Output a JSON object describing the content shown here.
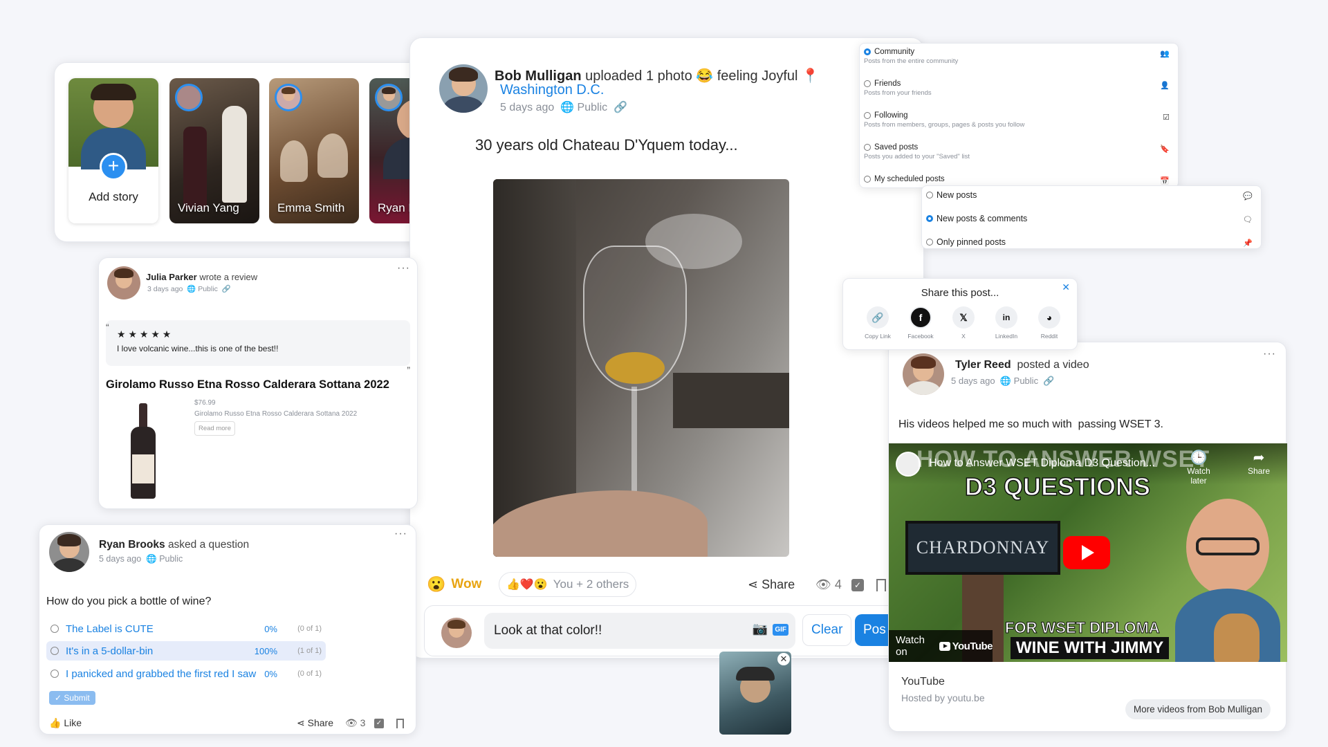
{
  "stories": {
    "add_label": "Add story",
    "items": [
      {
        "name": "Vivian Yang"
      },
      {
        "name": "Emma Smith"
      },
      {
        "name": "Ryan Brooks"
      }
    ]
  },
  "main_post": {
    "author": "Bob Mulligan",
    "action": "uploaded 1 photo 😂 feeling Joyful",
    "location": "Washington D.C.",
    "time": "5 days ago",
    "privacy": "Public",
    "text": "30 years old Chateau D'Yquem today...",
    "reaction_label": "Wow",
    "reaction_summary": "You + 2 others",
    "share_label": "Share",
    "views": "4",
    "comment_value": "Look at that color!!",
    "clear_label": "Clear",
    "post_label": "Pos",
    "gif_label": "GIF"
  },
  "review": {
    "author": "Julia Parker",
    "action": "wrote a review",
    "time": "3 days ago",
    "privacy": "Public",
    "rating": 5,
    "stars": "★ ★ ★ ★ ★",
    "quote": "I love volcanic wine...this is one of the best!!",
    "product_title": "Girolamo Russo Etna Rosso Calderara Sottana 2022",
    "price": "$76.99",
    "product_name": "Girolamo Russo Etna Rosso Calderara Sottana 2022",
    "read_more": "Read more"
  },
  "poll": {
    "author": "Ryan Brooks",
    "action": "asked a question",
    "time": "5 days ago",
    "privacy": "Public",
    "question": "How do you pick a bottle of wine?",
    "options": [
      {
        "label": "The Label is CUTE",
        "percent": "0%",
        "count": "(0 of 1)",
        "value": 0
      },
      {
        "label": "It's in a 5-dollar-bin",
        "percent": "100%",
        "count": "(1 of 1)",
        "value": 1
      },
      {
        "label": "I panicked and grabbed the first red I saw",
        "percent": "0%",
        "count": "(0 of 1)",
        "value": 0
      }
    ],
    "submit_label": "✓ Submit",
    "like_label": "Like",
    "share_label": "Share",
    "views": "3"
  },
  "feed_filter": {
    "items": [
      {
        "title": "Community",
        "subtitle": "Posts from the entire community",
        "selected": true,
        "icon": "users-icon"
      },
      {
        "title": "Friends",
        "subtitle": "Posts from your friends",
        "selected": false,
        "icon": "friends-icon"
      },
      {
        "title": "Following",
        "subtitle": "Posts from members, groups, pages & posts you follow",
        "selected": false,
        "icon": "check-square-icon"
      },
      {
        "title": "Saved posts",
        "subtitle": "Posts you added to your \"Saved\" list",
        "selected": false,
        "icon": "bookmark-icon"
      },
      {
        "title": "My scheduled posts",
        "subtitle": "",
        "selected": false,
        "icon": "calendar-icon"
      }
    ]
  },
  "sort_menu": {
    "items": [
      {
        "title": "New posts",
        "selected": false,
        "icon": "comment-icon"
      },
      {
        "title": "New posts & comments",
        "selected": true,
        "icon": "comments-icon"
      },
      {
        "title": "Only pinned posts",
        "selected": false,
        "icon": "pin-icon"
      }
    ]
  },
  "share_popup": {
    "title": "Share this post...",
    "buttons": [
      {
        "label": "Copy Link",
        "glyph": "🔗"
      },
      {
        "label": "Facebook",
        "glyph": "f"
      },
      {
        "label": "X",
        "glyph": "𝕏"
      },
      {
        "label": "LinkedIn",
        "glyph": "in"
      },
      {
        "label": "Reddit",
        "glyph": "◕"
      }
    ]
  },
  "video_post": {
    "author": "Tyler Reed",
    "action": "posted a video",
    "time": "5 days ago",
    "privacy": "Public",
    "text": "His videos helped me so much with  passing WSET 3.",
    "video_title": "How to Answer WSET Diploma D3 Question...",
    "thumb_headline_1": "HOW TO ANSWER WSET",
    "thumb_headline_2": "D3 QUESTIONS",
    "thumb_sign": "CHARDONNAY",
    "thumb_footer_1": "FOR WSET DIPLOMA",
    "thumb_footer_2": "WINE WITH JIMMY",
    "watch_later": "Watch later",
    "share": "Share",
    "watch_on": "Watch on",
    "youtube": "YouTube",
    "source": "YouTube",
    "hosted_by": "Hosted by youtu.be",
    "more_videos": "More videos from Bob Mulligan"
  },
  "colors": {
    "accent": "#1a82e2",
    "youtube_red": "#ff0000"
  }
}
